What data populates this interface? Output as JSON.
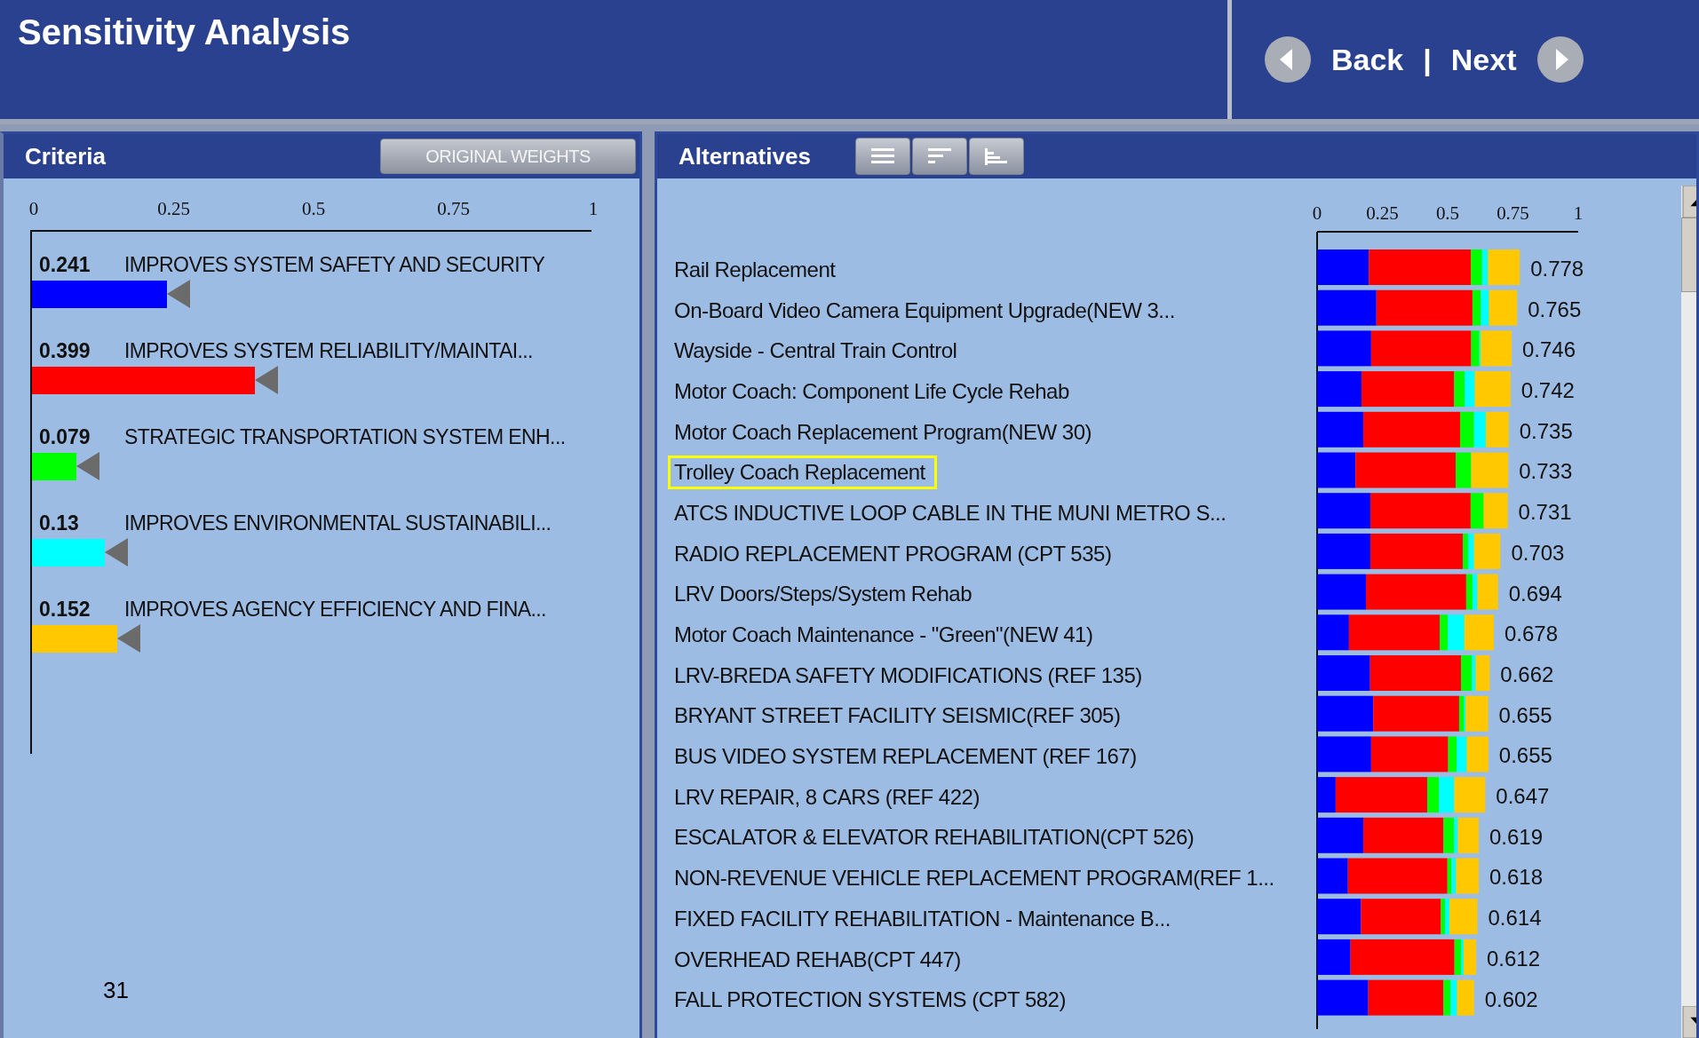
{
  "header": {
    "title": "Sensitivity Analysis",
    "back": "Back",
    "separator": "|",
    "next": "Next"
  },
  "criteria_panel": {
    "title": "Criteria",
    "reset_button": "ORIGINAL WEIGHTS",
    "scale_ticks": [
      "0",
      "0.25",
      "0.5",
      "0.75",
      "1"
    ],
    "criteria": [
      {
        "value": "0.241",
        "name": "IMPROVES SYSTEM SAFETY AND SECURITY",
        "level": 0.241,
        "color": "#0000ff"
      },
      {
        "value": "0.399",
        "name": "IMPROVES SYSTEM RELIABILITY/MAINTAI...",
        "level": 0.399,
        "color": "#ff0000"
      },
      {
        "value": "0.079",
        "name": "STRATEGIC TRANSPORTATION SYSTEM ENH...",
        "level": 0.079,
        "color": "#00ff00"
      },
      {
        "value": "0.13",
        "name": "IMPROVES ENVIRONMENTAL SUSTAINABILI...",
        "level": 0.13,
        "color": "#00ffff"
      },
      {
        "value": "0.152",
        "name": "IMPROVES AGENCY EFFICIENCY AND FINA...",
        "level": 0.152,
        "color": "#ffc800"
      }
    ],
    "page_number": "31"
  },
  "alternatives_panel": {
    "title": "Alternatives",
    "row_states": [
      {
        "selected": false
      },
      {
        "selected": false
      },
      {
        "selected": false
      },
      {
        "selected": false
      },
      {
        "selected": false
      },
      {
        "selected": true
      },
      {
        "selected": false
      },
      {
        "selected": false
      },
      {
        "selected": false
      },
      {
        "selected": false
      },
      {
        "selected": false
      },
      {
        "selected": false
      },
      {
        "selected": false
      },
      {
        "selected": false
      },
      {
        "selected": false
      },
      {
        "selected": false
      },
      {
        "selected": false
      },
      {
        "selected": false
      },
      {
        "selected": false
      }
    ],
    "chart_data": {
      "type": "bar",
      "orientation": "horizontal",
      "stacked": true,
      "xlim": [
        0,
        1
      ],
      "xticks": [
        0,
        0.25,
        0.5,
        0.75,
        1
      ],
      "categories": [
        "Rail Replacement",
        "On-Board Video Camera Equipment Upgrade(NEW 3...",
        "Wayside - Central Train Control",
        "Motor Coach: Component Life Cycle Rehab",
        "Motor Coach Replacement Program(NEW 30)",
        "Trolley Coach Replacement",
        "ATCS INDUCTIVE LOOP CABLE IN THE MUNI METRO S...",
        "RADIO REPLACEMENT PROGRAM (CPT 535)",
        "LRV Doors/Steps/System Rehab",
        "Motor Coach Maintenance - \"Green\"(NEW 41)",
        "LRV-BREDA SAFETY MODIFICATIONS (REF 135)",
        "BRYANT STREET FACILITY SEISMIC(REF 305)",
        "BUS VIDEO SYSTEM REPLACEMENT (REF 167)",
        "LRV REPAIR, 8 CARS (REF 422)",
        "ESCALATOR & ELEVATOR REHABILITATION(CPT 526)",
        "NON-REVENUE VEHICLE REPLACEMENT PROGRAM(REF 1...",
        "FIXED FACILITY REHABILITATION - Maintenance B...",
        "OVERHEAD REHAB(CPT 447)",
        "FALL PROTECTION SYSTEMS (CPT 582)"
      ],
      "series": [
        {
          "color": "#0000ff",
          "values": [
            0.198,
            0.227,
            0.207,
            0.17,
            0.177,
            0.147,
            0.204,
            0.204,
            0.187,
            0.122,
            0.203,
            0.215,
            0.207,
            0.071,
            0.177,
            0.118,
            0.168,
            0.128,
            0.196
          ]
        },
        {
          "color": "#ff0000",
          "values": [
            0.391,
            0.368,
            0.383,
            0.355,
            0.371,
            0.384,
            0.384,
            0.354,
            0.384,
            0.348,
            0.348,
            0.329,
            0.295,
            0.351,
            0.307,
            0.381,
            0.306,
            0.398,
            0.288
          ]
        },
        {
          "color": "#00ff00",
          "values": [
            0.043,
            0.032,
            0.031,
            0.04,
            0.053,
            0.059,
            0.05,
            0.02,
            0.024,
            0.031,
            0.041,
            0.019,
            0.032,
            0.045,
            0.04,
            0.016,
            0.016,
            0.025,
            0.027
          ]
        },
        {
          "color": "#00ffff",
          "values": [
            0.022,
            0.031,
            0.005,
            0.039,
            0.045,
            0,
            0,
            0.023,
            0.019,
            0.063,
            0.015,
            0.006,
            0.039,
            0.058,
            0.015,
            0.017,
            0.017,
            0.01,
            0.025
          ]
        },
        {
          "color": "#ffc800",
          "values": [
            0.122,
            0.108,
            0.119,
            0.137,
            0.088,
            0.142,
            0.092,
            0.101,
            0.079,
            0.113,
            0.054,
            0.086,
            0.083,
            0.119,
            0.08,
            0.087,
            0.107,
            0.048,
            0.065
          ]
        }
      ],
      "value_labels": [
        "0.778",
        "0.765",
        "0.746",
        "0.742",
        "0.735",
        "0.733",
        "0.731",
        "0.703",
        "0.694",
        "0.678",
        "0.662",
        "0.655",
        "0.655",
        "0.647",
        "0.619",
        "0.618",
        "0.614",
        "0.612",
        "0.602"
      ]
    }
  }
}
